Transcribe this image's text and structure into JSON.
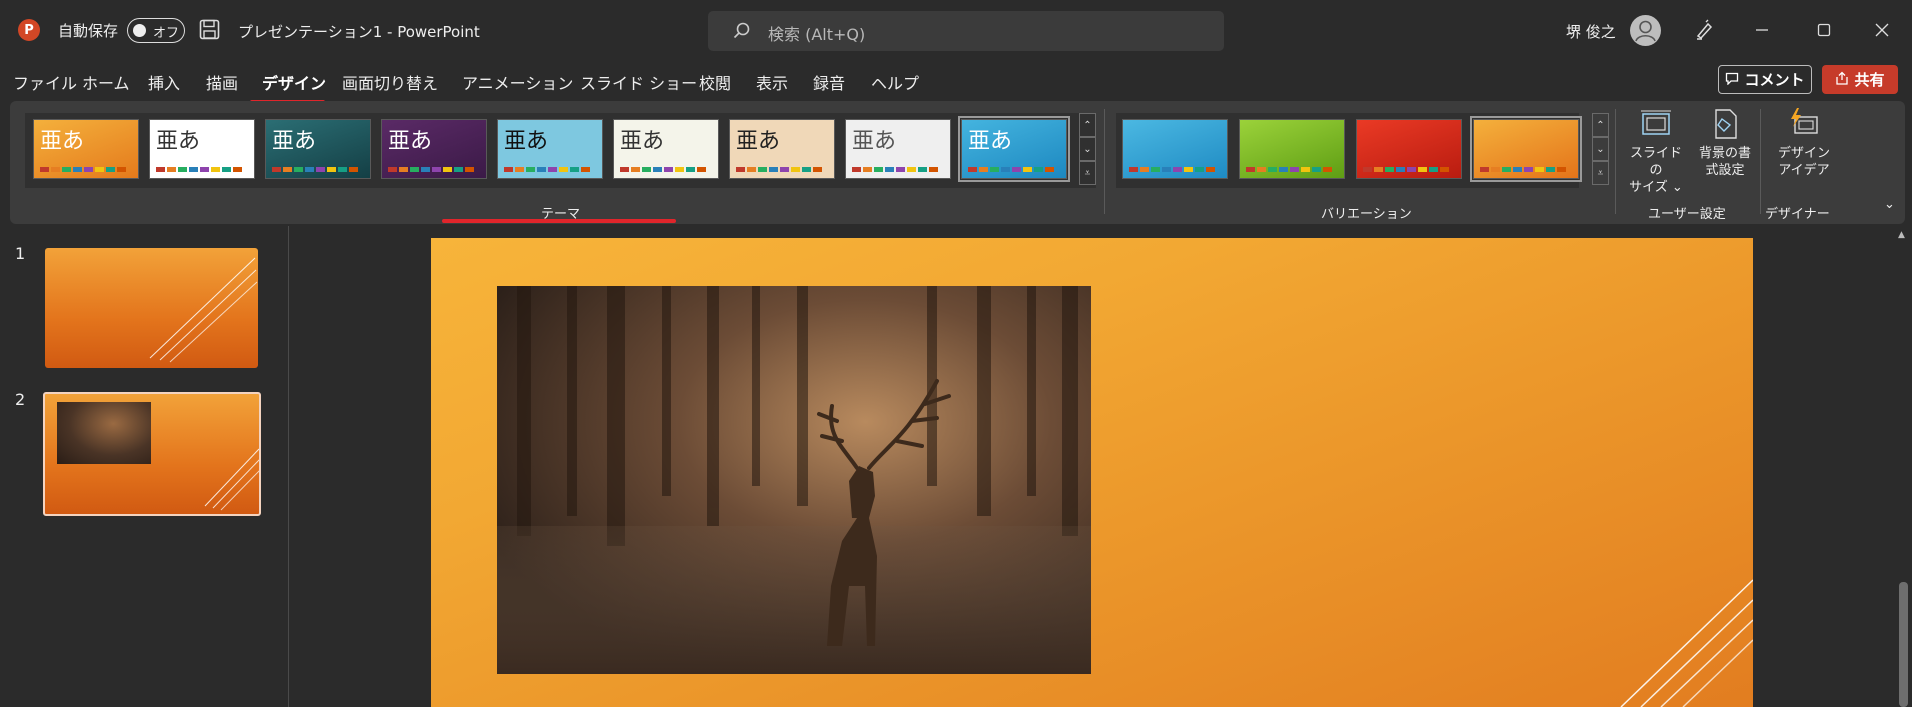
{
  "titlebar": {
    "logo_letter": "P",
    "autosave_label": "自動保存",
    "autosave_state": "オフ",
    "doc_title": "プレゼンテーション1  -  PowerPoint",
    "search_placeholder": "検索 (Alt+Q)",
    "user_name": "堺 俊之"
  },
  "menu": {
    "tabs": [
      "ファイル",
      "ホーム",
      "挿入",
      "描画",
      "デザイン",
      "画面切り替え",
      "アニメーション",
      "スライド ショー",
      "校閲",
      "表示",
      "録音",
      "ヘルプ"
    ],
    "active_tab": "デザイン",
    "comment_label": "コメント",
    "share_label": "共有"
  },
  "ribbon": {
    "themes": [
      {
        "text": "亜あ",
        "bg": "linear-gradient(160deg,#f4b03c,#e47a1c)",
        "color": "#ffffff"
      },
      {
        "text": "亜あ",
        "bg": "#ffffff",
        "color": "#333333"
      },
      {
        "text": "亜あ",
        "bg": "linear-gradient(160deg,#2b6e74,#143f45)",
        "color": "#ffffff"
      },
      {
        "text": "亜あ",
        "bg": "linear-gradient(160deg,#5a2a66,#3b1a47)",
        "color": "#ffffff"
      },
      {
        "text": "亜あ",
        "bg": "#7ec8e0",
        "color": "#111111"
      },
      {
        "text": "亜あ",
        "bg": "#f4f4ea",
        "color": "#333333"
      },
      {
        "text": "亜あ",
        "bg": "#f0d8b8",
        "color": "#222222"
      },
      {
        "text": "亜あ",
        "bg": "#efefef",
        "color": "#555555"
      },
      {
        "text": "亜あ",
        "bg": "linear-gradient(160deg,#44b4df,#1d88c0)",
        "color": "#ffffff"
      }
    ],
    "themes_label": "テーマ",
    "variants": [
      {
        "bg": "linear-gradient(160deg,#4bb8e2,#1f8bc3)"
      },
      {
        "bg": "linear-gradient(160deg,#9bd23a,#5f9e14)"
      },
      {
        "bg": "linear-gradient(160deg,#ea3a25,#b91c10)"
      },
      {
        "bg": "linear-gradient(160deg,#f4b03c,#e4741a)"
      }
    ],
    "variants_label": "バリエーション",
    "slide_size_label": "スライドの\nサイズ ⌄",
    "bg_format_label": "背景の書\n式設定",
    "user_settings_label": "ユーザー設定",
    "designer_button_label": "デザイン\nアイデア",
    "designer_group_label": "デザイナー"
  },
  "slides": {
    "numbers": [
      "1",
      "2"
    ],
    "selected": "2"
  },
  "colors": {
    "accent_red": "#e0252b",
    "share_bg": "#c63b2a",
    "slide_orange": "#f2a833"
  }
}
